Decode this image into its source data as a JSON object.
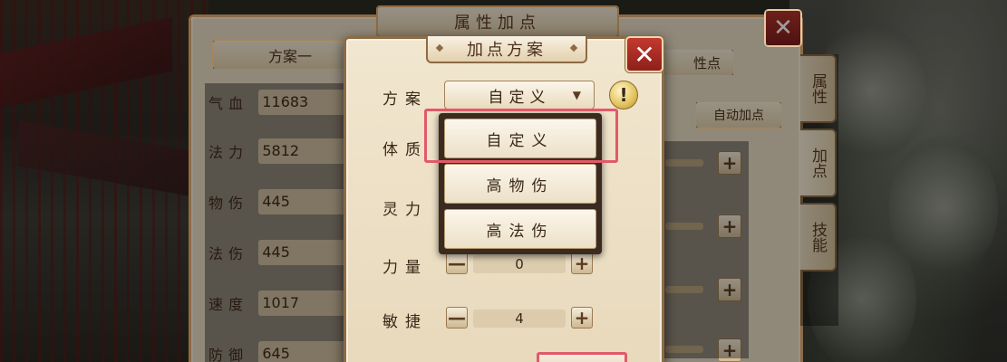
{
  "outer_panel": {
    "title": "属性加点",
    "close": "✕",
    "scheme_tab": "方案一",
    "scheme_tab_right": "性点",
    "auto_button": "自动加点",
    "stats": [
      {
        "label": "气血",
        "value": "11683"
      },
      {
        "label": "法力",
        "value": "5812"
      },
      {
        "label": "物伤",
        "value": "445"
      },
      {
        "label": "法伤",
        "value": "445"
      },
      {
        "label": "速度",
        "value": "1017"
      },
      {
        "label": "防御",
        "value": "645"
      }
    ],
    "side_tabs": [
      {
        "label": "属性"
      },
      {
        "label": "加点"
      },
      {
        "label": "技能"
      }
    ],
    "plus_glyph": "+"
  },
  "modal": {
    "title": "加点方案",
    "close": "✕",
    "scheme_label": "方案",
    "scheme_value": "自定义",
    "dropdown_arrow": "▼",
    "warn_glyph": "!",
    "minus_glyph": "—",
    "plus_glyph": "+",
    "rows": [
      {
        "label": "体质"
      },
      {
        "label": "灵力"
      },
      {
        "label": "力量",
        "value": "0"
      },
      {
        "label": "敏捷",
        "value": "4"
      }
    ],
    "dropdown_options": [
      "自定义",
      "高物伤",
      "高法伤"
    ]
  },
  "colors": {
    "highlight": "#e05a6a",
    "close_red": "#b3342c",
    "panel": "#e9dcc4",
    "border": "#8c6b45"
  }
}
